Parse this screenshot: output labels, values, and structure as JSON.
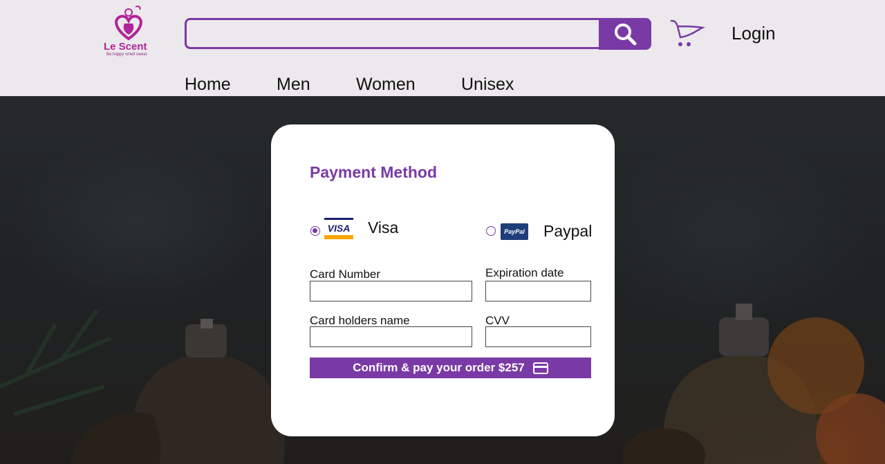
{
  "brand": {
    "name": "Le Scent",
    "tagline": "Be happy smell sweet"
  },
  "header": {
    "search": {
      "value": "",
      "placeholder": ""
    },
    "search_icon": "search-icon",
    "cart_icon": "cart-icon",
    "login_label": "Login"
  },
  "nav": {
    "items": [
      {
        "label": "Home"
      },
      {
        "label": "Men"
      },
      {
        "label": "Women"
      },
      {
        "label": "Unisex"
      }
    ]
  },
  "payment": {
    "title": "Payment Method",
    "options": [
      {
        "label": "Visa",
        "logo_text": "VISA",
        "selected": true
      },
      {
        "label": "Paypal",
        "logo_text": "PayPal",
        "selected": false
      }
    ],
    "fields": {
      "card_number": {
        "label": "Card Number",
        "value": ""
      },
      "expiration": {
        "label": "Expiration date",
        "value": ""
      },
      "holder_name": {
        "label": "Card holders name",
        "value": ""
      },
      "cvv": {
        "label": "CVV",
        "value": ""
      }
    },
    "confirm_label": "Confirm & pay your order $257",
    "confirm_icon": "credit-card-icon"
  },
  "colors": {
    "accent": "#7a3aa6",
    "brand_pink": "#b0239a",
    "header_bg": "#ece9ec",
    "card_bg": "#ffffff"
  }
}
